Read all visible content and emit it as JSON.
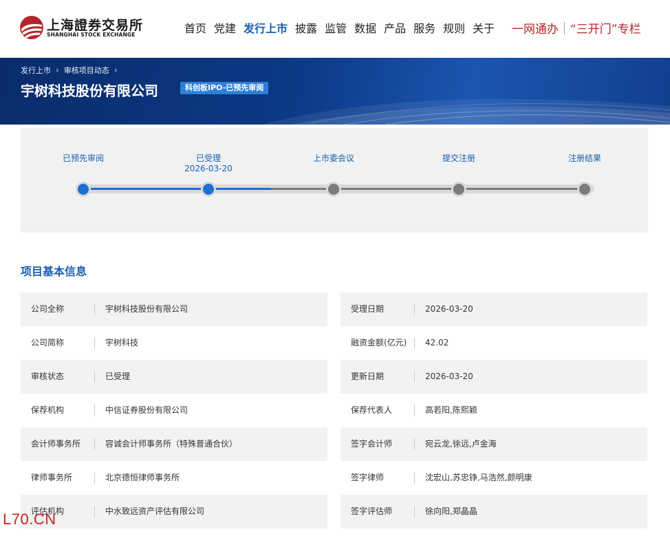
{
  "header": {
    "logo": {
      "cn": "上海證券交易所",
      "en": "SHANGHAI STOCK EXCHANGE",
      "brand_color": "#b3262b"
    },
    "nav": [
      {
        "label": "首页",
        "active": false
      },
      {
        "label": "党建",
        "active": false
      },
      {
        "label": "发行上市",
        "active": true
      },
      {
        "label": "披露",
        "active": false
      },
      {
        "label": "监管",
        "active": false
      },
      {
        "label": "数据",
        "active": false
      },
      {
        "label": "产品",
        "active": false
      },
      {
        "label": "服务",
        "active": false
      },
      {
        "label": "规则",
        "active": false
      },
      {
        "label": "关于",
        "active": false
      }
    ],
    "quick_links": [
      "一网通办",
      "“三开门”专栏"
    ]
  },
  "banner": {
    "breadcrumb": [
      "发行上市",
      "审核项目动态"
    ],
    "title": "宇树科技股份有限公司",
    "status_tag": "科创板IPO-已预先审阅"
  },
  "progress": {
    "steps": [
      {
        "label": "已预先审阅",
        "date": "",
        "done": true
      },
      {
        "label": "已受理",
        "date": "2026-03-20",
        "done": true
      },
      {
        "label": "上市委会议",
        "date": "",
        "done": false
      },
      {
        "label": "提交注册",
        "date": "",
        "done": false
      },
      {
        "label": "注册结果",
        "date": "",
        "done": false
      }
    ]
  },
  "info": {
    "title": "项目基本信息",
    "left": [
      {
        "label": "公司全称",
        "value": "宇树科技股份有限公司"
      },
      {
        "label": "公司简称",
        "value": "宇树科技"
      },
      {
        "label": "审核状态",
        "value": "已受理"
      },
      {
        "label": "保荐机构",
        "value": "中信证券股份有限公司"
      },
      {
        "label": "会计师事务所",
        "value": "容诚会计师事务所（特殊普通合伙）"
      },
      {
        "label": "律师事务所",
        "value": "北京德恒律师事务所"
      },
      {
        "label": "评估机构",
        "value": "中水致远资产评估有限公司"
      }
    ],
    "right": [
      {
        "label": "受理日期",
        "value": "2026-03-20"
      },
      {
        "label": "融资金额(亿元)",
        "value": "42.02"
      },
      {
        "label": "更新日期",
        "value": "2026-03-20"
      },
      {
        "label": "保荐代表人",
        "value": "高若阳,陈熙颖"
      },
      {
        "label": "签字会计师",
        "value": "宛云龙,徐远,卢金海"
      },
      {
        "label": "签字律师",
        "value": "沈宏山,苏忠铮,马浩然,颜明康"
      },
      {
        "label": "签字评估师",
        "value": "徐向阳,郑晶晶"
      }
    ]
  },
  "watermark": "L70.CN",
  "colors": {
    "accent_blue": "#1a5fad",
    "progress_blue": "#1b6fd0",
    "brand_red": "#b3262b"
  }
}
